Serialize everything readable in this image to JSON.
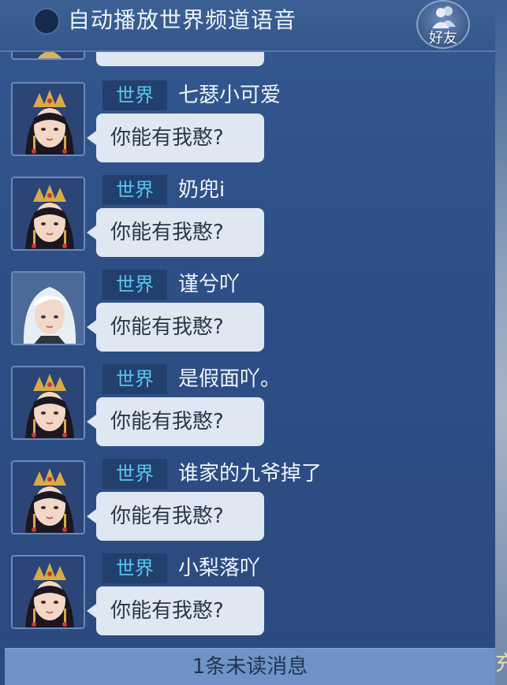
{
  "header": {
    "title": "自动播放世界频道语音",
    "friends_label": "好友"
  },
  "background_text": {
    "right_edge": "充"
  },
  "messages": [
    {
      "channel": "世界",
      "sender": "七瑟小可爱",
      "text": "你能有我憨?",
      "avatar": "female-crowned"
    },
    {
      "channel": "世界",
      "sender": "奶兜i",
      "text": "你能有我憨?",
      "avatar": "female-crowned"
    },
    {
      "channel": "世界",
      "sender": "谨兮吖",
      "text": "你能有我憨?",
      "avatar": "male-white-hair"
    },
    {
      "channel": "世界",
      "sender": "是假面吖。",
      "text": "你能有我憨?",
      "avatar": "female-crowned"
    },
    {
      "channel": "世界",
      "sender": "谁家的九爷掉了",
      "text": "你能有我憨?",
      "avatar": "female-crowned"
    },
    {
      "channel": "世界",
      "sender": "小梨落吖",
      "text": "你能有我憨?",
      "avatar": "female-crowned"
    }
  ],
  "unread_bar": {
    "label": "1条未读消息"
  },
  "colors": {
    "channel_tag_text": "#58c6f0",
    "panel_bg": "#2d4f86",
    "bubble_bg": "#dfe7f2",
    "unread_bar_bg": "#6f93c7"
  }
}
